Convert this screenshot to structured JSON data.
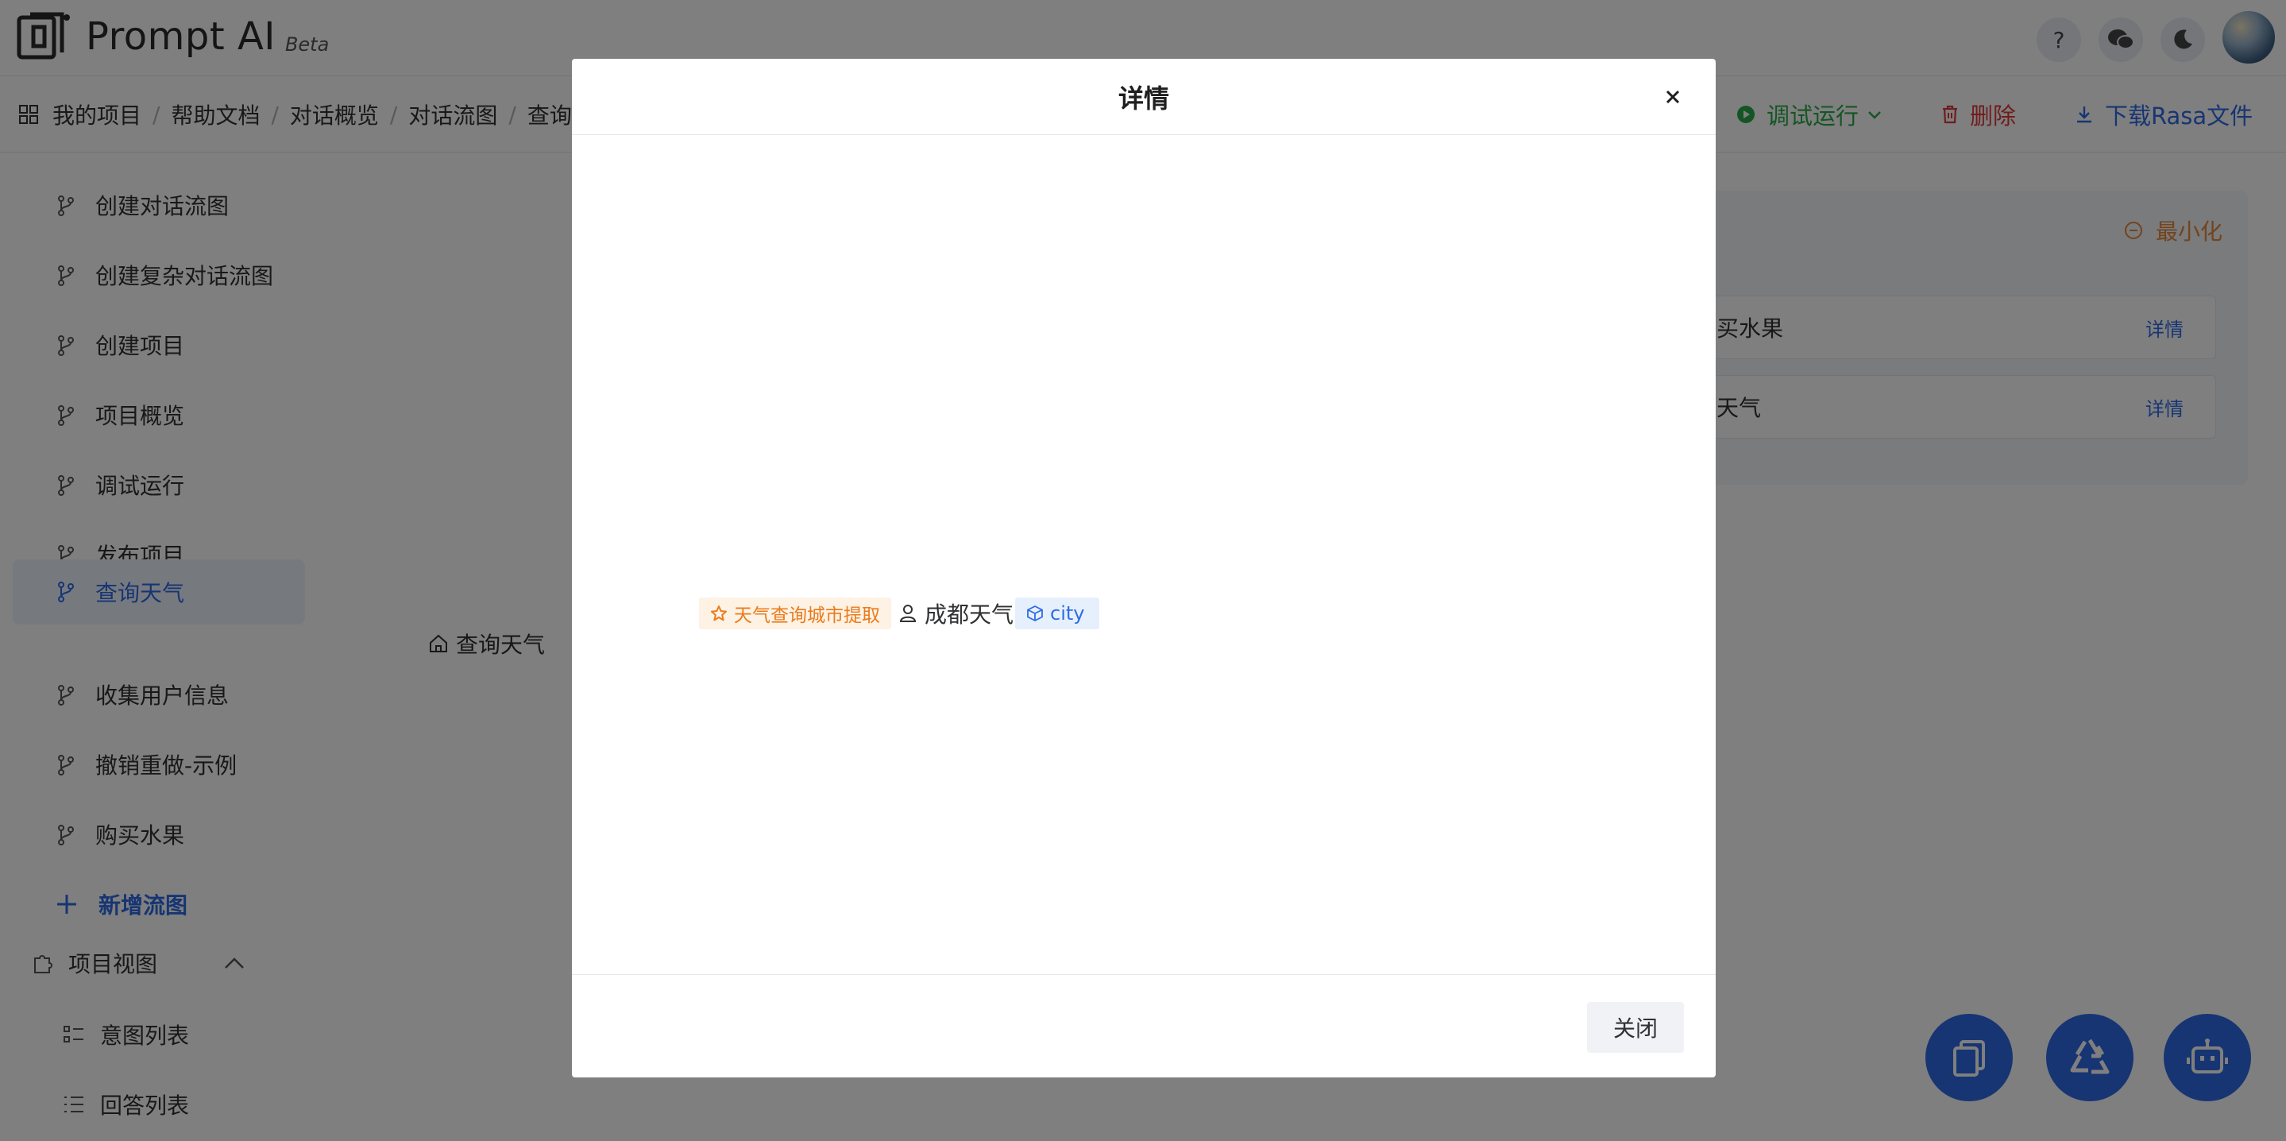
{
  "header": {
    "brand": "Prompt AI",
    "beta": "Beta"
  },
  "breadcrumb": [
    "我的项目",
    "帮助文档",
    "对话概览",
    "对话流图",
    "查询天气"
  ],
  "toolbar": {
    "debug_run": "调试运行",
    "delete": "删除",
    "download": "下载Rasa文件"
  },
  "sidebar": {
    "items": [
      {
        "label": "创建对话流图"
      },
      {
        "label": "创建复杂对话流图"
      },
      {
        "label": "创建项目"
      },
      {
        "label": "项目概览"
      },
      {
        "label": "调试运行"
      },
      {
        "label": "发布项目"
      },
      {
        "label": "查询天气",
        "active": true
      },
      {
        "label": "收集用户信息"
      },
      {
        "label": "撤销重做-示例"
      },
      {
        "label": "购买水果"
      }
    ],
    "add_label": "新增流图",
    "section_label": "项目视图",
    "sub_items": [
      "意图列表",
      "回答列表"
    ]
  },
  "canvas": {
    "node_label": "查询天气"
  },
  "right_panel": {
    "minimize_label": "最小化",
    "cards": [
      {
        "name": "买水果",
        "detail": "详情"
      },
      {
        "name": "天气",
        "detail": "详情"
      }
    ]
  },
  "modal": {
    "title": "详情",
    "close_label": "关闭",
    "example": {
      "intent": "天气查询城市提取",
      "user_text": "成都天气",
      "entity": "city"
    }
  },
  "colors": {
    "primary": "#2e6be6",
    "success": "#2bab4a",
    "danger": "#e0393b",
    "warning": "#ea7b1d"
  }
}
